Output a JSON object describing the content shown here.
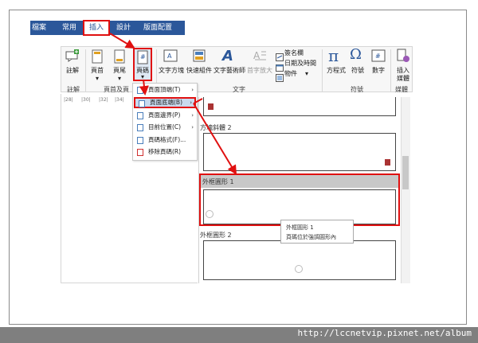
{
  "tabs": [
    "檔案",
    "常用",
    "插入",
    "設計",
    "版面配置"
  ],
  "ribbon": {
    "comment": "註解",
    "header": "頁首",
    "footer": "頁尾",
    "page_number": "頁碼",
    "textbox": "文字方塊",
    "quickparts": "快速組件",
    "wordart": "文字藝術師",
    "dropcap": "首字放大",
    "signature": "簽名欄",
    "datetime": "日期及時間",
    "object": "物件",
    "equation": "方程式",
    "symbol": "符號",
    "number": "數字",
    "insert_media": "插入",
    "insert_media2": "媒體",
    "groups": {
      "comments": "註解",
      "headerfooter": "頁首及頁",
      "text": "文字",
      "symbols": "符號",
      "media": "媒體"
    }
  },
  "ruler": [
    "|28|",
    "|30|",
    "|32|",
    "|34|"
  ],
  "menu": {
    "items": [
      {
        "label": "頁面頂端(T)",
        "arrow": "›"
      },
      {
        "label": "頁面底端(B)",
        "arrow": "›"
      },
      {
        "label": "頁面邊界(P)",
        "arrow": "›"
      },
      {
        "label": "目前位置(C)",
        "arrow": "›"
      },
      {
        "label": "頁碼格式(F)...",
        "arrow": ""
      },
      {
        "label": "移除頁碼(R)",
        "arrow": ""
      }
    ]
  },
  "gallery": {
    "item1": "方塊斜體 2",
    "item2": "外框圓形 1",
    "item3": "外框圓形 2"
  },
  "tooltip": {
    "line1": "外框圓形 1",
    "line2": "頁碼位於強調圓形內"
  },
  "footer_url": "http://lccnetvip.pixnet.net/album"
}
